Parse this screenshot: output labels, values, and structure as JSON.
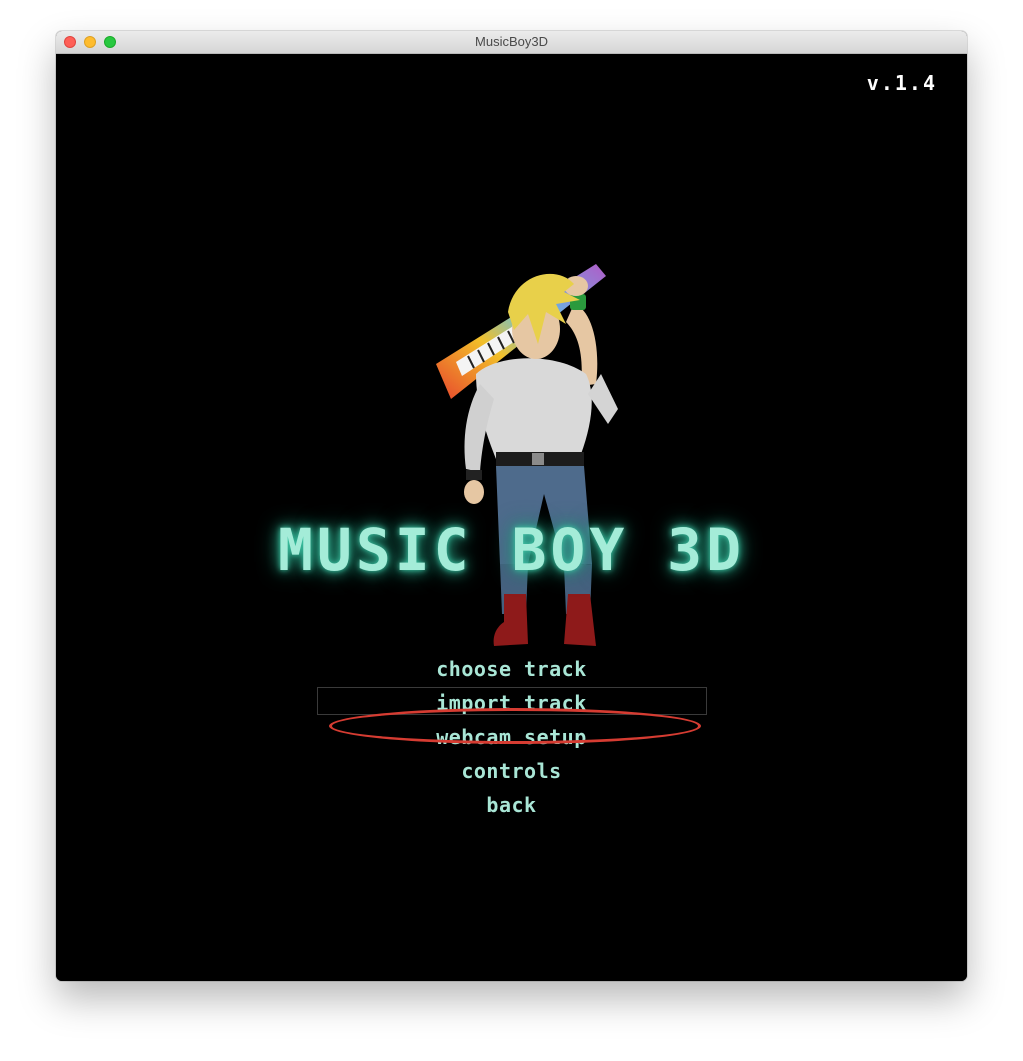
{
  "window": {
    "title": "MusicBoy3D"
  },
  "game": {
    "version": "v.1.4",
    "logo_text": "MUSIC BOY 3D",
    "menu": [
      {
        "label": "choose track",
        "selected": false
      },
      {
        "label": "import track",
        "selected": true
      },
      {
        "label": "webcam setup",
        "selected": false
      },
      {
        "label": "controls",
        "selected": false
      },
      {
        "label": "back",
        "selected": false
      }
    ]
  },
  "colors": {
    "menu_text": "#a9e6d6",
    "logo_glow": "#3fc9a8",
    "annotation": "#d63c32",
    "background": "#000000"
  },
  "icons": [
    "close-window-icon",
    "minimize-window-icon",
    "maximize-window-icon"
  ]
}
